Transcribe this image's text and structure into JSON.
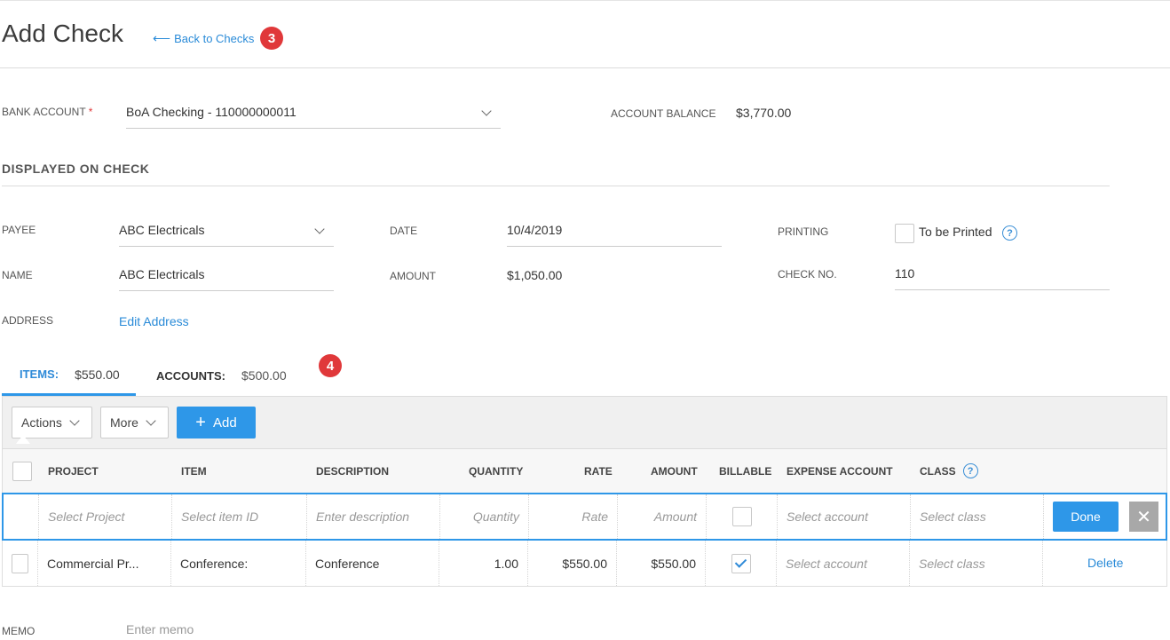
{
  "header": {
    "title": "Add Check",
    "back_label": "Back to Checks",
    "badge_top": "3"
  },
  "bank": {
    "label": "BANK ACCOUNT",
    "value": "BoA Checking - 110000000011",
    "balance_label": "ACCOUNT BALANCE",
    "balance_value": "$3,770.00"
  },
  "section": {
    "title": "DISPLAYED ON CHECK"
  },
  "fields": {
    "payee_label": "PAYEE",
    "payee_value": "ABC Electricals",
    "name_label": "NAME",
    "name_value": "ABC Electricals",
    "address_label": "ADDRESS",
    "address_link": "Edit Address",
    "date_label": "DATE",
    "date_value": "10/4/2019",
    "amount_label": "AMOUNT",
    "amount_value": "$1,050.00",
    "printing_label": "PRINTING",
    "printing_option": "To be Printed",
    "checkno_label": "CHECK NO.",
    "checkno_value": "110"
  },
  "tabs": {
    "items_label": "ITEMS:",
    "items_value": "$550.00",
    "accounts_label": "ACCOUNTS:",
    "accounts_value": "$500.00",
    "badge": "4"
  },
  "toolbar": {
    "actions": "Actions",
    "more": "More",
    "add": "Add"
  },
  "columns": {
    "project": "PROJECT",
    "item": "ITEM",
    "description": "DESCRIPTION",
    "quantity": "QUANTITY",
    "rate": "RATE",
    "amount": "AMOUNT",
    "billable": "BILLABLE",
    "expense_account": "EXPENSE ACCOUNT",
    "class": "CLASS"
  },
  "edit_row": {
    "project": "Select Project",
    "item": "Select item ID",
    "description": "Enter description",
    "quantity": "Quantity",
    "rate": "Rate",
    "amount": "Amount",
    "account": "Select account",
    "class": "Select class",
    "done": "Done"
  },
  "row1": {
    "project": "Commercial Pr...",
    "item": "Conference:",
    "description": "Conference",
    "quantity": "1.00",
    "rate": "$550.00",
    "amount": "$550.00",
    "account": "Select account",
    "class": "Select class",
    "delete": "Delete"
  },
  "memo": {
    "label": "MEMO",
    "placeholder": "Enter memo"
  },
  "colors": {
    "accent": "#2e97e8",
    "badge": "#e0383a"
  }
}
